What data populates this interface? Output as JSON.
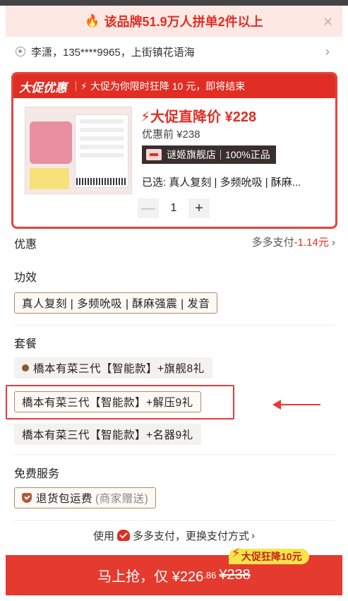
{
  "banner": {
    "text": "该品牌51.9万人拼单2件以上",
    "close": "×"
  },
  "address": {
    "text": "李潇，135****9965，上街镇花语海",
    "chevron": "›"
  },
  "promo": {
    "logo": "大促优惠",
    "message": "大促为你限时狂降 10 元，即将结束",
    "price_main": "大促直降价 ¥228",
    "price_before": "优惠前 ¥238",
    "store_name": "谜姬旗舰店",
    "store_badge": "100%正品",
    "selected": "已选: 真人复刻 | 多频吮吸 | 酥麻...",
    "qty": "1",
    "minus": "—",
    "plus": "+"
  },
  "discount": {
    "label": "优惠",
    "right_prefix": "多多支付",
    "right_amount": "-1.14元",
    "chevron": "›"
  },
  "function": {
    "title": "功效",
    "chip": "真人复刻 | 多频吮吸 | 酥麻强震 | 发音"
  },
  "package": {
    "title": "套餐",
    "options": [
      "橋本有菜三代【智能款】+旗舰8礼",
      "橋本有菜三代【智能款】+解压9礼",
      "橋本有菜三代【智能款】+名器9礼"
    ]
  },
  "service": {
    "title": "免费服务",
    "chip_main": "退货包运费",
    "chip_note": "(商家赠送)"
  },
  "payment": {
    "prefix": "使用",
    "method": "多多支付，更换支付方式",
    "chevron": "›"
  },
  "buy": {
    "label": "马上抢，仅 ¥226",
    "cents": ".86",
    "original": "¥238",
    "tag": "大促狂降10元",
    "tag_icon": "lightning-icon"
  },
  "colors": {
    "accent": "#e02e24",
    "banner_bg": "#fde8e4",
    "buy_bg": "#e53a2e",
    "tag_bg": "#f7e34a"
  }
}
